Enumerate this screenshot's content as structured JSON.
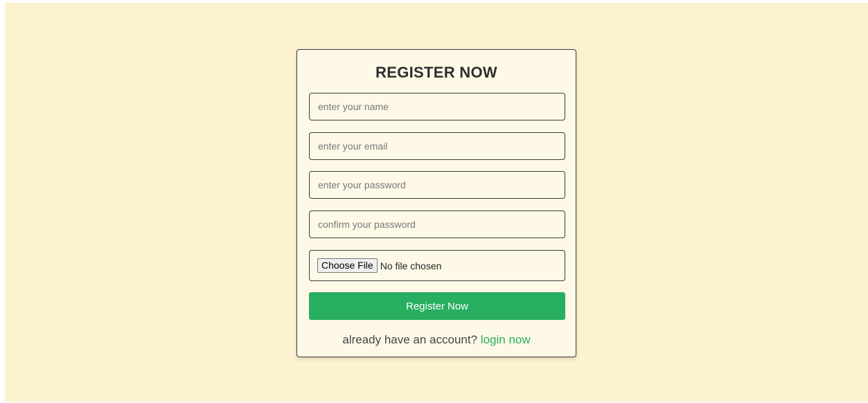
{
  "form": {
    "title": "REGISTER NOW",
    "name_placeholder": "enter your name",
    "email_placeholder": "enter your email",
    "password_placeholder": "enter your password",
    "confirm_placeholder": "confirm your password",
    "file_button_label": "Choose File",
    "file_status": "No file chosen",
    "submit_label": "Register Now",
    "login_prompt": "already have an account?",
    "login_link": "login now"
  },
  "colors": {
    "page_background": "#fcf2d0",
    "card_background": "#fef9e7",
    "accent": "#27ae60"
  }
}
